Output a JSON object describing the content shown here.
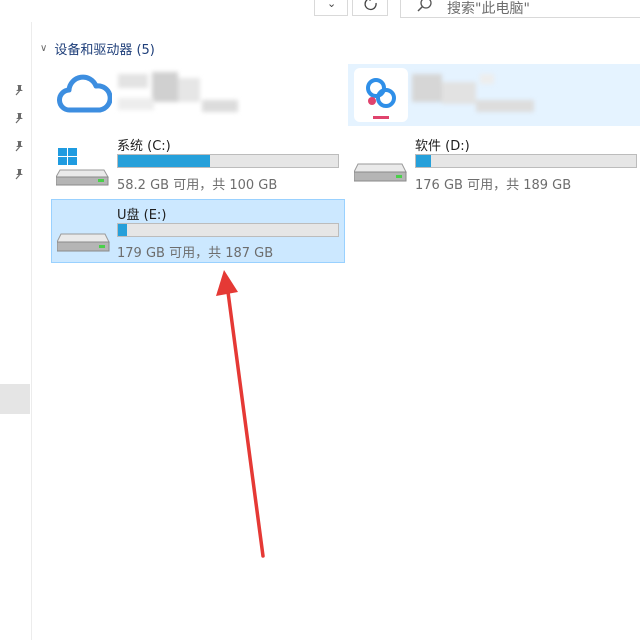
{
  "search": {
    "placeholder": "搜索\"此电脑\""
  },
  "group": {
    "title": "设备和驱动器 (5)"
  },
  "drives": [
    {
      "name": "系统 (C:)",
      "free_text": "58.2 GB 可用，共 100 GB",
      "used_fraction": 0.418,
      "icon": "windows-drive-icon"
    },
    {
      "name": "软件 (D:)",
      "free_text": "176 GB 可用，共 189 GB",
      "used_fraction": 0.069,
      "icon": "hard-drive-icon"
    },
    {
      "name": "U盘 (E:)",
      "free_text": "179 GB 可用，共 187 GB",
      "used_fraction": 0.043,
      "icon": "hard-drive-icon"
    }
  ],
  "colors": {
    "accent": "#26a0da",
    "selected_bg": "#cce8ff",
    "selected_border": "#99d1ff",
    "arrow": "#e53935"
  }
}
